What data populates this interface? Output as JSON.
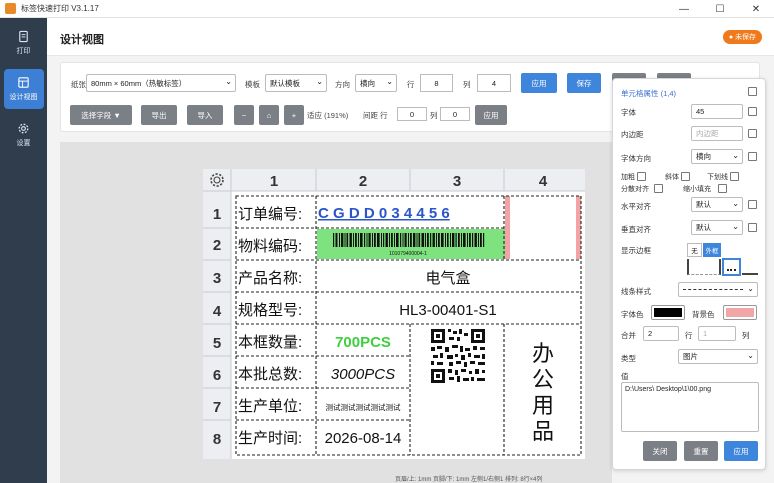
{
  "window": {
    "title": "标签快速打印 V3.1.17",
    "min": "—",
    "max": "☐",
    "close": "✕"
  },
  "nav": [
    {
      "label": "打印",
      "icon": "document-icon"
    },
    {
      "label": "设计视图",
      "icon": "layout-icon",
      "active": true
    },
    {
      "label": "设置",
      "icon": "gear-icon"
    }
  ],
  "header": {
    "title": "设计视图",
    "badge": "● 未保存"
  },
  "toolbar": {
    "paper_label": "纸张",
    "paper_value": "80mm × 60mm（热敏标签）",
    "template_label": "模板",
    "template_value": "默认模板",
    "direction_label": "方向",
    "direction_value": "横向",
    "rows_label": "行",
    "rows_value": "8",
    "cols_label": "列",
    "cols_value": "4",
    "apply": "应用",
    "save": "保存",
    "select_field": "选择字段 ▼",
    "export": "导出",
    "import": "导入",
    "zoom_out": "−",
    "zoom_reset": "⌂",
    "zoom_in": "+",
    "fit_label": "适应 (191%)",
    "spacing_label": "间距 行",
    "spacing_row": "0",
    "spacing_col_label": "列",
    "spacing_col": "0",
    "spacing_apply": "应用"
  },
  "grid": {
    "col_headers": [
      "1",
      "2",
      "3",
      "4"
    ],
    "row_headers": [
      "1",
      "2",
      "3",
      "4",
      "5",
      "6",
      "7",
      "8"
    ],
    "cells": {
      "r1c1": "订单编号:",
      "r1c2": "C G D D 0 3 4 4 5 6",
      "r2c1": "物料编码:",
      "r2_barcode_text": "101079400004-1",
      "r3c1": "产品名称:",
      "r3c2": "电气盒",
      "r4c1": "规格型号:",
      "r4c2": "HL3-00401-S1",
      "r5c1": "本框数量:",
      "r5c2": "700PCS",
      "r6c1": "本批总数:",
      "r6c2": "3000PCS",
      "r7c1": "生产单位:",
      "r7c2": "测试测试测试测试测试",
      "r8c1": "生产时间:",
      "r8c2": "2026-08-14",
      "vertical_text": [
        "办",
        "公",
        "用",
        "品"
      ]
    }
  },
  "footer": "页眉/上: 1mm 页脚/下: 1mm 左侧1/右侧1 排列: 8行×4列",
  "props": {
    "title": "单元格属性 (1,4)",
    "font_label": "字体",
    "font_value": "45",
    "padding_label": "内边距",
    "padding_placeholder": "内边距",
    "dir_label": "字体方向",
    "dir_value": "横向",
    "bold": "加粗",
    "italic": "斜体",
    "underline": "下划线",
    "justify": "分散对齐",
    "shrink": "缩小填充",
    "halign_label": "水平对齐",
    "halign_value": "默认",
    "valign_label": "垂直对齐",
    "valign_value": "默认",
    "border_label": "显示边框",
    "border_none": "无",
    "border_outer": "外框",
    "line_label": "线条样式",
    "fontcolor_label": "字体色",
    "bgcolor_label": "背景色",
    "merge_label": "合并",
    "merge_row": "2",
    "merge_row_label": "行",
    "merge_col": "1",
    "merge_col_label": "列",
    "type_label": "类型",
    "type_value": "图片",
    "value_label": "值",
    "value_text": "D:\\Users\\      Desktop\\1\\00.png",
    "close": "关闭",
    "reset": "重置",
    "apply": "应用",
    "colors": {
      "font": "#000000",
      "bg": "#f3a6a8",
      "accent": "#3e86dc"
    }
  }
}
